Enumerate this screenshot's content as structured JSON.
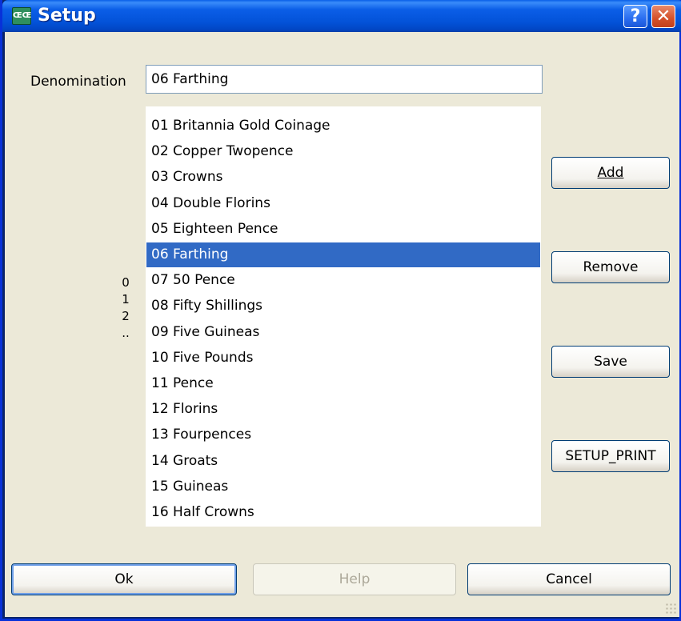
{
  "window": {
    "title": "Setup",
    "icon_text": "ŒŒ",
    "help_glyph": "?",
    "close_glyph": "✕"
  },
  "denomination": {
    "label": "Denomination",
    "value": "06 Farthing"
  },
  "side_digits": [
    "0",
    "1",
    "2",
    ".."
  ],
  "list": {
    "selected_index": 5,
    "items": [
      "01 Britannia Gold Coinage",
      "02 Copper Twopence",
      "03 Crowns",
      "04 Double Florins",
      "05 Eighteen Pence",
      "06 Farthing",
      "07 50 Pence",
      "08 Fifty Shillings",
      "09 Five Guineas",
      "10 Five Pounds",
      "11 Pence",
      "12 Florins",
      "13 Fourpences",
      "14 Groats",
      "15 Guineas",
      "16 Half Crowns"
    ]
  },
  "side_buttons": {
    "add": "Add",
    "remove": "Remove",
    "save": "Save",
    "setup_print": "SETUP_PRINT"
  },
  "bottom_buttons": {
    "ok": "Ok",
    "help": "Help",
    "cancel": "Cancel"
  },
  "colors": {
    "selection": "#316ac5",
    "titlebar": "#0352d8",
    "dialog_bg": "#ece9d8"
  }
}
